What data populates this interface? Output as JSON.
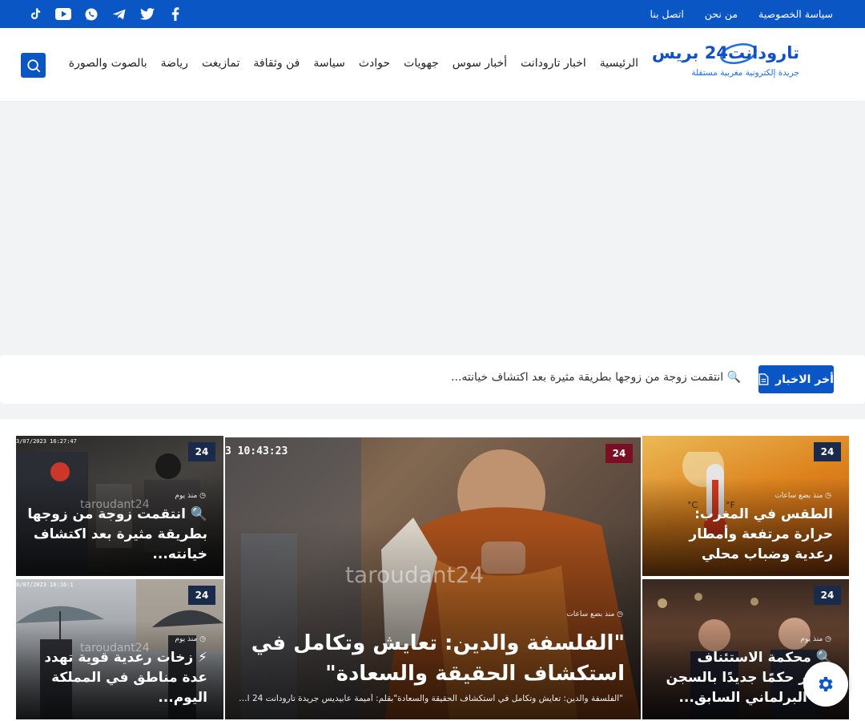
{
  "topbar": {
    "links": [
      "سياسة الخصوصية",
      "من نحن",
      "اتصل بنا"
    ],
    "social_icons": [
      "facebook-icon",
      "twitter-icon",
      "telegram-icon",
      "whatsapp-icon",
      "youtube-icon",
      "tiktok-icon"
    ]
  },
  "header": {
    "logo_brand": "تارودانت24 بريس",
    "logo_tagline": "جريدة إلكترونية مغربية مستقلة",
    "nav": [
      "الرئيسية",
      "اخبار تارودانت",
      "أخبار سوس",
      "جهويات",
      "حوادث",
      "سياسة",
      "فن وثقافة",
      "تمازيغت",
      "رياضة",
      "بالصوت والصورة"
    ]
  },
  "ticker": {
    "label": "أخر الاخبار",
    "text": "🔍 انتقمت زوجة من زوجها بطريقة مثيرة بعد اكتشاف خيانته..."
  },
  "cards": {
    "right_top": {
      "badge": "24",
      "meta": "منذ بضع ساعات",
      "title": "الطقس في المغرب: حرارة مرتفعة وأمطار رعدية وضباب محلي"
    },
    "right_bottom": {
      "badge": "24",
      "meta": "منذ يوم",
      "title": "🔍 محكمة الاستئناف تصدر حكمًا جديدًا بالسجن ضد البرلماني السابق..."
    },
    "center": {
      "badge": "24",
      "timestamp": "3 10:43:23",
      "watermark": "taroudant24",
      "meta": "منذ بضع ساعات",
      "title": "\"الفلسفة والدين: تعايش وتكامل في استكشاف الحقيقة والسعادة\"",
      "excerpt": "\"الفلسفة والدين: تعايش وتكامل في استكشاف الحقيقة والسعادة\"بقلم: أميمة عابيديس جريدة تارودانت 24 ال..."
    },
    "left_top": {
      "badge": "24",
      "timestamp": "3/07/2023 16:27:47",
      "watermark": "taroudant24",
      "meta": "منذ يوم",
      "title": "🔍 انتقمت زوجة من زوجها بطريقة مثيرة بعد اكتشاف خيانته..."
    },
    "left_bottom": {
      "badge": "24",
      "timestamp": "8/07/2023 16:16:1",
      "watermark": "taroudant24",
      "meta": "منذ يوم",
      "title": "⚡ زخات رعدية قوية تهدد عدة مناطق في المملكة اليوم..."
    }
  },
  "colors": {
    "primary": "#0a56c4",
    "badge_dark": "#1a2a4a",
    "badge_red": "#7a0e22"
  }
}
